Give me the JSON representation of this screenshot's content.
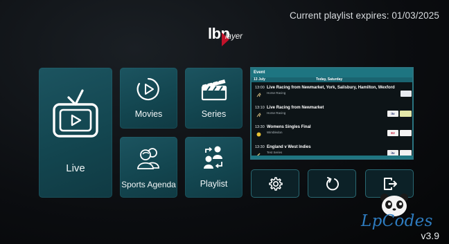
{
  "header": {
    "expires_text": "Current playlist expires: 01/03/2025"
  },
  "logo": {
    "lbp": "lbp",
    "player": "layer"
  },
  "tiles": {
    "live": "Live",
    "movies": "Movies",
    "series": "Series",
    "sports": "Sports Agenda",
    "playlist": "Playlist"
  },
  "epg": {
    "header": "Event",
    "date_left": "13 July",
    "date_right": "Today, Saturday",
    "rows": [
      {
        "time": "13:00",
        "title": "Live Racing from Newmarket, York, Salisbury, Hamilton, Wexford",
        "subtitle": "Horse Racing"
      },
      {
        "time": "13:10",
        "title": "Live Racing from Newmarket",
        "subtitle": "Horse Racing"
      },
      {
        "time": "13:30",
        "title": "Womens Singles Final",
        "subtitle": "Wimbledon"
      },
      {
        "time": "13:30",
        "title": "England v West Indies",
        "subtitle": "Test Series"
      }
    ],
    "channels": {
      "c1": "itv",
      "c2": "itv",
      "c3": "E2",
      "c4": ""
    }
  },
  "buttons": {
    "settings": "gear-icon",
    "refresh": "refresh-icon",
    "exit": "exit-icon"
  },
  "watermark": "LpCodes",
  "version": "v3.9",
  "colors": {
    "tile": "#174e59",
    "accent": "#1e7581",
    "brand_red": "#c3122a"
  }
}
